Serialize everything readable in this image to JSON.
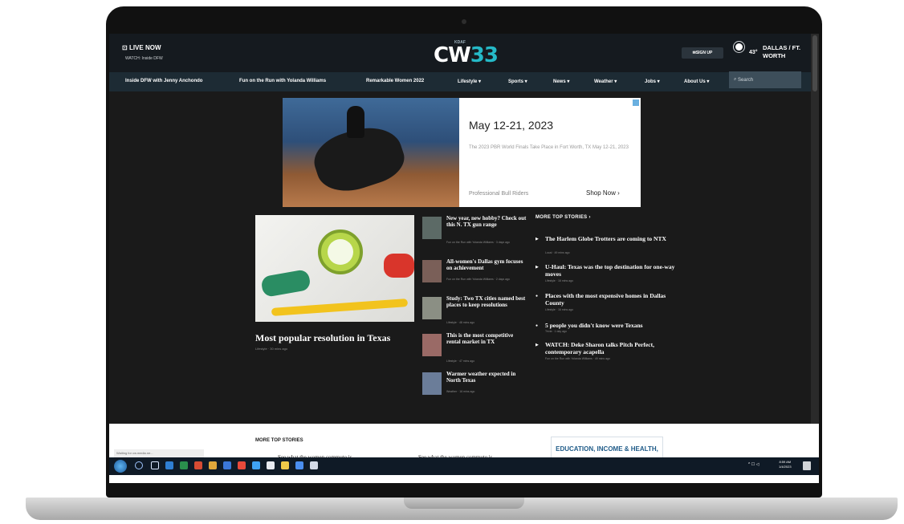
{
  "header": {
    "live_label": "LIVE NOW",
    "live_sub": "WATCH: Inside DFW",
    "logo_small": "KDAF",
    "logo_main_a": "CW",
    "logo_main_b": "33",
    "signup_label": "SIGN UP",
    "temperature": "43°",
    "city": "DALLAS / FT. WORTH"
  },
  "nav": {
    "items": [
      "Inside DFW with Jenny Anchondo",
      "Fun on the Run with Yolanda Williams",
      "Remarkable Women 2022",
      "Lifestyle ▾",
      "Sports ▾",
      "News ▾",
      "Weather ▾",
      "Jobs ▾",
      "About Us ▾"
    ],
    "search_placeholder": "Search"
  },
  "ad": {
    "title": "May 12-21, 2023",
    "description": "The 2023 PBR World Finals Take Place in Fort Worth, TX May 12-21, 2023",
    "brand": "Professional Bull Riders",
    "cta": "Shop Now ›"
  },
  "lead": {
    "title": "Most popular resolution in Texas",
    "meta": "Lifestyle · 30 mins ago"
  },
  "mid_stories": [
    {
      "title": "New year, new hobby? Check out this N. TX gun range",
      "meta": "Fun on the Run with Yolanda Williams · 3 days ago"
    },
    {
      "title": "All-women's Dallas gym focuses on achievement",
      "meta": "Fun on the Run with Yolanda Williams · 2 days ago"
    },
    {
      "title": "Study: Two TX cities named best places to keep resolutions",
      "meta": "Lifestyle · 48 mins ago"
    },
    {
      "title": "This is the most competitive rental market in TX",
      "meta": "Lifestyle · 47 mins ago"
    },
    {
      "title": "Warmer weather expected in North Texas",
      "meta": "Weather · 16 mins ago"
    }
  ],
  "more_top": {
    "heading": "MORE TOP STORIES ›",
    "items": [
      {
        "title": "The Harlem Globe Trotters are coming to NTX",
        "meta": "Local · 49 mins ago"
      },
      {
        "title": "U-Haul: Texas was the top destination for one-way moves",
        "meta": "Lifestyle · 16 mins ago"
      },
      {
        "title": "Places with the most expensive homes in Dallas County",
        "meta": "Lifestyle · 16 mins ago"
      },
      {
        "title": "5 people you didn't know were Texans",
        "meta": "Trivia · 1 day ago"
      },
      {
        "title": "WATCH: Deke Sharon talks Pitch Perfect, contemporary acapella",
        "meta": "Fun on the Run with Yolanda Williams · 49 mins ago"
      }
    ]
  },
  "lower": {
    "heading": "MORE TOP STORIES",
    "status": "Waiting for cw.media.ne...",
    "edu_ad": "EDUCATION, INCOME & HEALTH,",
    "partial_1": "See what the women commute is",
    "partial_2": "See what the women commute is"
  },
  "taskbar": {
    "tray": "^ ☐ ◁",
    "time": "8:59 AM",
    "date": "1/4/2023"
  },
  "colors": {
    "accent": "#25b9c7",
    "header": "#151a1f",
    "nav": "#1d2b34",
    "page": "#1a1a1a"
  }
}
